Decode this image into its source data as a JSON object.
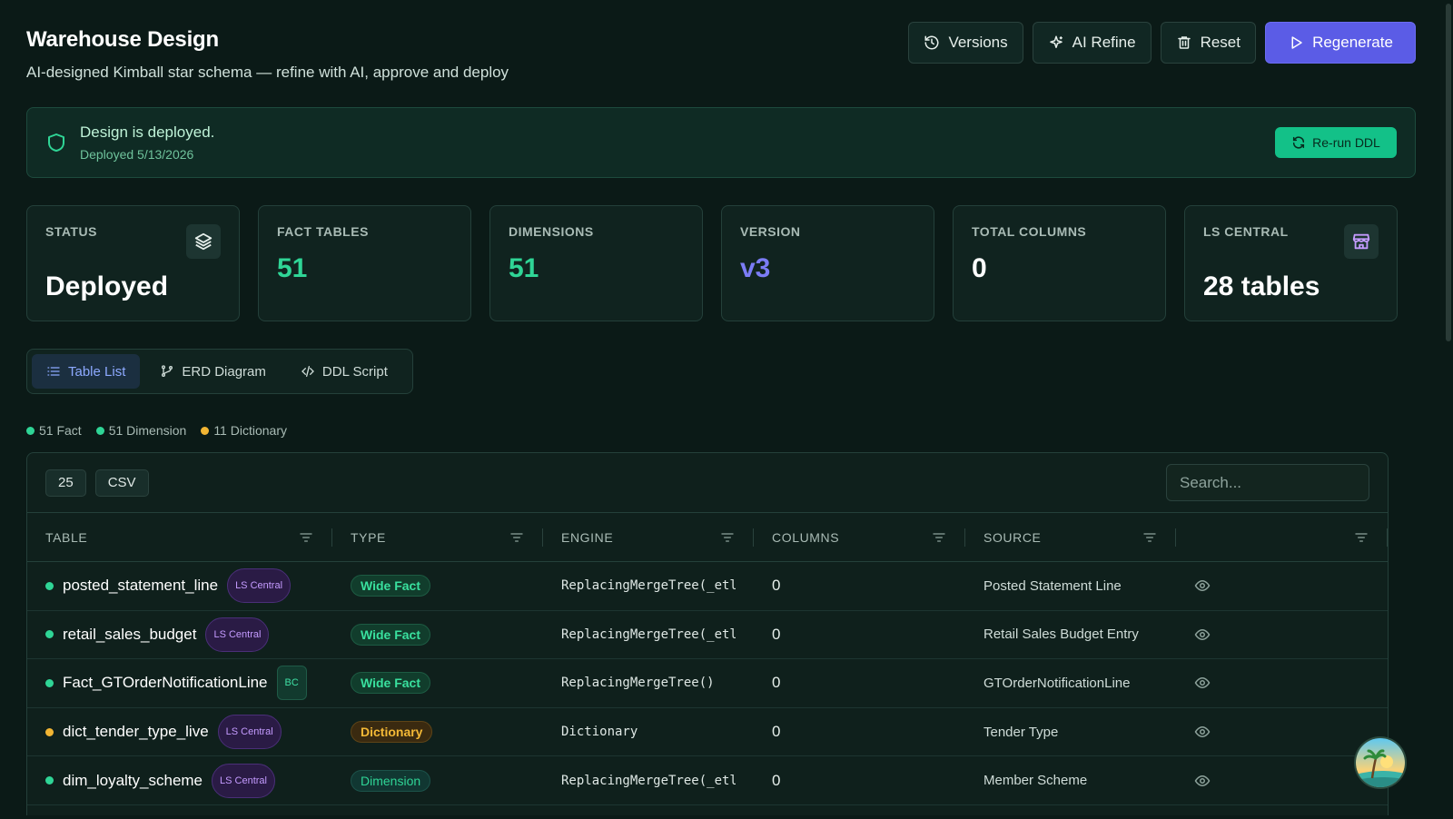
{
  "header": {
    "title": "Warehouse Design",
    "subtitle": "AI-designed Kimball star schema — refine with AI, approve and deploy",
    "buttons": {
      "versions": "Versions",
      "ai_refine": "AI Refine",
      "reset": "Reset",
      "regenerate": "Regenerate"
    }
  },
  "banner": {
    "title": "Design is deployed.",
    "subtitle": "Deployed 5/13/2026",
    "rerun_label": "Re-run DDL"
  },
  "stats": [
    {
      "label": "STATUS",
      "value": "Deployed"
    },
    {
      "label": "FACT TABLES",
      "value": "51"
    },
    {
      "label": "DIMENSIONS",
      "value": "51"
    },
    {
      "label": "VERSION",
      "value": "v3"
    },
    {
      "label": "TOTAL COLUMNS",
      "value": "0"
    },
    {
      "label": "LS CENTRAL",
      "value": "28 tables"
    }
  ],
  "tabs": [
    {
      "label": "Table List",
      "active": true
    },
    {
      "label": "ERD Diagram",
      "active": false
    },
    {
      "label": "DDL Script",
      "active": false
    }
  ],
  "legend": [
    {
      "label": "51 Fact",
      "color": "#2fd596"
    },
    {
      "label": "51 Dimension",
      "color": "#2fd596"
    },
    {
      "label": "11 Dictionary",
      "color": "#f2b533"
    }
  ],
  "toolbar": {
    "page_size": "25",
    "csv_label": "CSV",
    "search_placeholder": "Search..."
  },
  "table": {
    "headers": [
      "TABLE",
      "TYPE",
      "ENGINE",
      "COLUMNS",
      "SOURCE",
      ""
    ],
    "rows": [
      {
        "name": "posted_statement_line",
        "source_badge": "LS Central",
        "type": "Wide Fact",
        "engine": "ReplacingMergeTree(_etl_",
        "columns": "0",
        "source": "Posted Statement Line"
      },
      {
        "name": "retail_sales_budget",
        "source_badge": "LS Central",
        "type": "Wide Fact",
        "engine": "ReplacingMergeTree(_etl_",
        "columns": "0",
        "source": "Retail Sales Budget Entry"
      },
      {
        "name": "Fact_GTOrderNotificationLine",
        "source_badge": "BC",
        "type": "Wide Fact",
        "engine": "ReplacingMergeTree()",
        "columns": "0",
        "source": "GTOrderNotificationLine"
      },
      {
        "name": "dict_tender_type_live",
        "source_badge": "LS Central",
        "type": "Dictionary",
        "engine": "Dictionary",
        "columns": "0",
        "source": "Tender Type"
      },
      {
        "name": "dim_loyalty_scheme",
        "source_badge": "LS Central",
        "type": "Dimension",
        "engine": "ReplacingMergeTree(_etl_",
        "columns": "0",
        "source": "Member Scheme"
      }
    ]
  }
}
